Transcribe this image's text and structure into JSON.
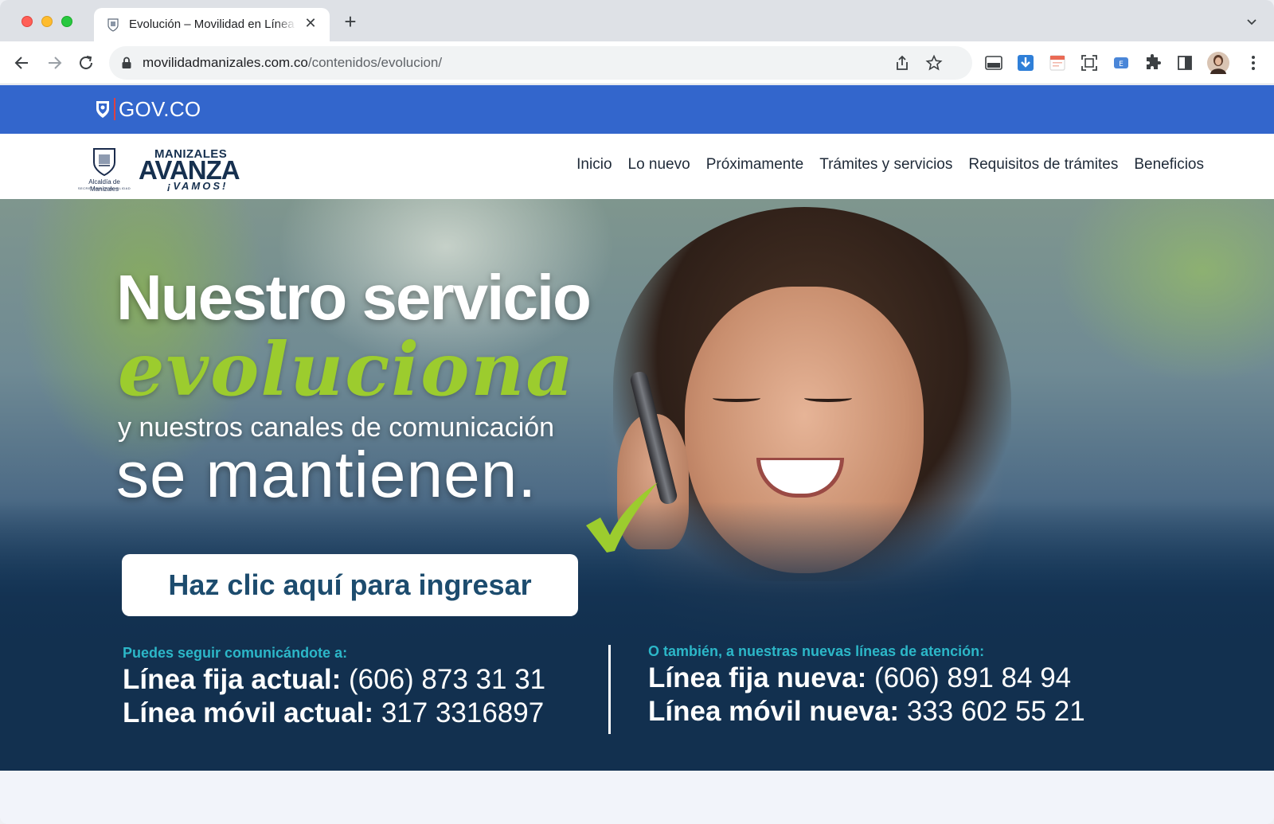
{
  "browser": {
    "tab_title": "Evolución – Movilidad en Línea",
    "url_host": "movilidadmanizales.com.co",
    "url_path": "/contenidos/evolucion/"
  },
  "gov_bar": {
    "label": "GOV.CO"
  },
  "logos": {
    "alcaldia_name": "Alcaldía de Manizales",
    "alcaldia_sub": "SECRETARÍA DE MOVILIDAD",
    "avanza_top": "MANIZALES",
    "avanza_main": "AVANZA",
    "avanza_sub": "¡VAMOS!"
  },
  "nav": {
    "items": [
      {
        "label": "Inicio"
      },
      {
        "label": "Lo nuevo"
      },
      {
        "label": "Próximamente"
      },
      {
        "label": "Trámites y servicios"
      },
      {
        "label": "Requisitos de trámites"
      },
      {
        "label": "Beneficios"
      }
    ]
  },
  "hero": {
    "line1": "Nuestro servicio",
    "line2": "evoluciona",
    "line3": "y nuestros canales de comunicación",
    "line4": "se mantienen.",
    "cta_label": "Haz clic aquí para ingresar",
    "accent_green": "#9ccc2e",
    "accent_cyan": "#2cb7c8",
    "navy": "#12304f"
  },
  "contacts": {
    "left": {
      "heading": "Puedes seguir comunicándote a:",
      "fixed_label": "Línea fija actual:",
      "fixed_value": "(606) 873 31 31",
      "mobile_label": "Línea móvil actual:",
      "mobile_value": "317 3316897"
    },
    "right": {
      "heading": "O también, a nuestras nuevas líneas de atención:",
      "fixed_label": "Línea fija nueva:",
      "fixed_value": "(606) 891 84 94",
      "mobile_label": "Línea móvil nueva:",
      "mobile_value": "333 602 55 21"
    }
  }
}
